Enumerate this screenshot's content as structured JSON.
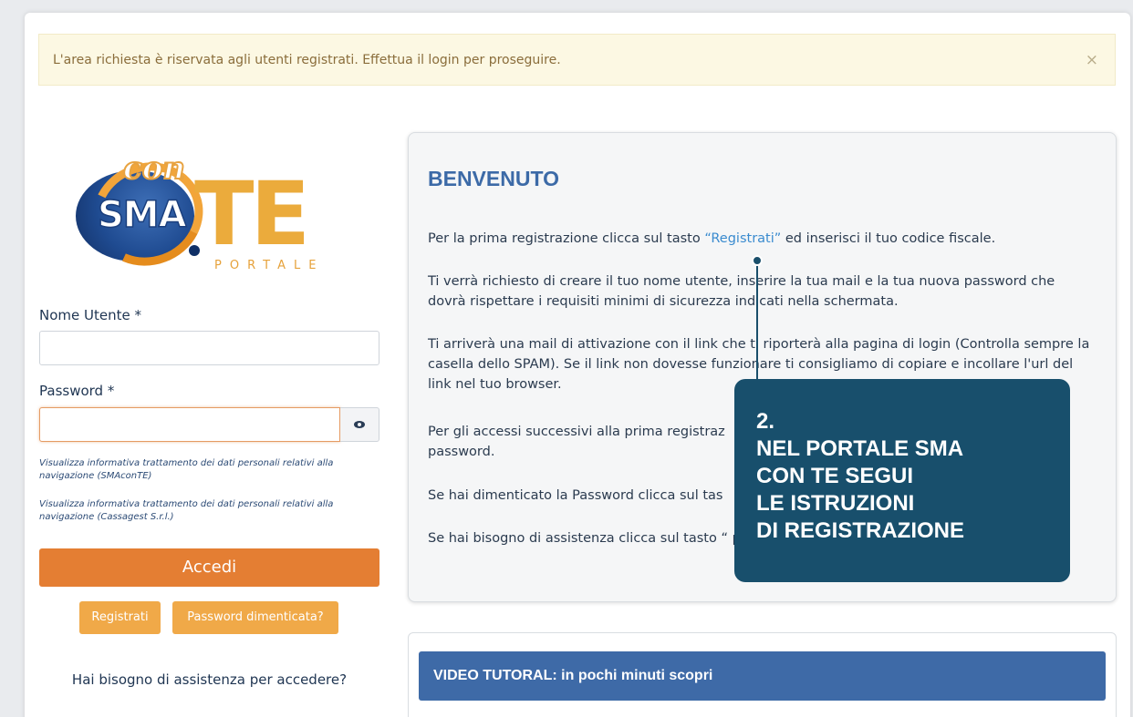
{
  "alert": {
    "message": "L'area richiesta è riservata agli utenti registrati. Effettua il login per proseguire.",
    "close_symbol": "×"
  },
  "logo": {
    "con": "con",
    "sma": "SMA",
    "te": "TE",
    "portale": "PORTALE"
  },
  "login": {
    "username_label": "Nome Utente *",
    "username_value": "",
    "password_label": "Password *",
    "password_value": "",
    "privacy_link_1": "Visualizza informativa trattamento dei dati personali relativi alla navigazione (SMAconTE)",
    "privacy_link_2": "Visualizza informativa trattamento dei dati personali relativi alla navigazione (Cassagest S.r.l.)",
    "submit_label": "Accedi",
    "register_label": "Registrati",
    "forgot_label": "Password dimenticata?",
    "help_text": "Hai bisogno di assistenza per accedere?"
  },
  "welcome": {
    "title": "BENVENUTO",
    "p1_before": "Per la prima registrazione clicca sul tasto ",
    "p1_link": "“Registrati”",
    "p1_after": " ed inserisci il tuo codice fiscale.",
    "p2": "Ti verrà richiesto di creare il tuo nome utente, inserire la tua mail e la tua nuova password che dovrà rispettare i requisiti minimi di sicurezza indicati nella schermata.",
    "p3": "Ti arriverà una mail di attivazione con il link che ti riporterà alla pagina di login (Controlla sempre la casella dello SPAM). Se il link non dovesse funzionare ti consigliamo di copiare e incollare l'url del link nel tuo browser.",
    "p4": "Per gli accessi successivi alla prima registraz password.",
    "p5": "Se hai dimenticato la Password clicca sul tas",
    "p6": "Se hai bisogno di assistenza clicca sul tasto “ pila il form."
  },
  "video": {
    "title": "VIDEO TUTORAL: in pochi minuti scopri"
  },
  "callout": {
    "line1": "2.",
    "line2": "NEL PORTALE SMA",
    "line3": "CON TE SEGUI",
    "line4": "LE ISTRUZIONI",
    "line5": "DI REGISTRAZIONE"
  },
  "colors": {
    "accent_orange": "#e47e33",
    "button_orange_light": "#f0a948",
    "title_blue": "#3c6aa7",
    "callout_teal": "#184f6c",
    "alert_bg": "#fcf8e3"
  }
}
